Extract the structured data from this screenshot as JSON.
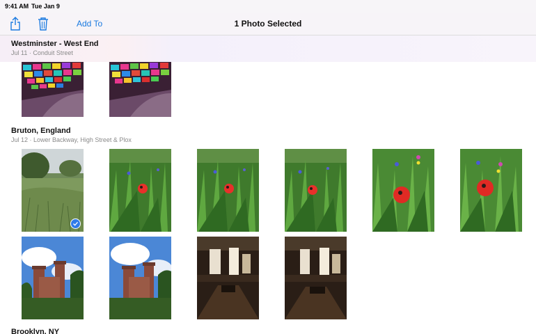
{
  "status_bar": {
    "time": "9:41 AM",
    "date": "Tue Jan 9"
  },
  "toolbar": {
    "share_icon": "share-icon",
    "trash_icon": "trash-icon",
    "add_to_label": "Add To",
    "title": "1 Photo Selected"
  },
  "sections": [
    {
      "title": "Westminster - West End",
      "subtitle": "Jul 11 · Conduit Street",
      "photo_count": 2
    },
    {
      "title": "Bruton, England",
      "subtitle": "Jul 12 · Lower Backway, High Street & Plox",
      "photo_count": 10,
      "selected_photo_index": 0
    },
    {
      "title": "Brooklyn, NY"
    }
  ],
  "colors": {
    "accent": "#1a7ae0",
    "selection_badge": "#2f7be8"
  }
}
